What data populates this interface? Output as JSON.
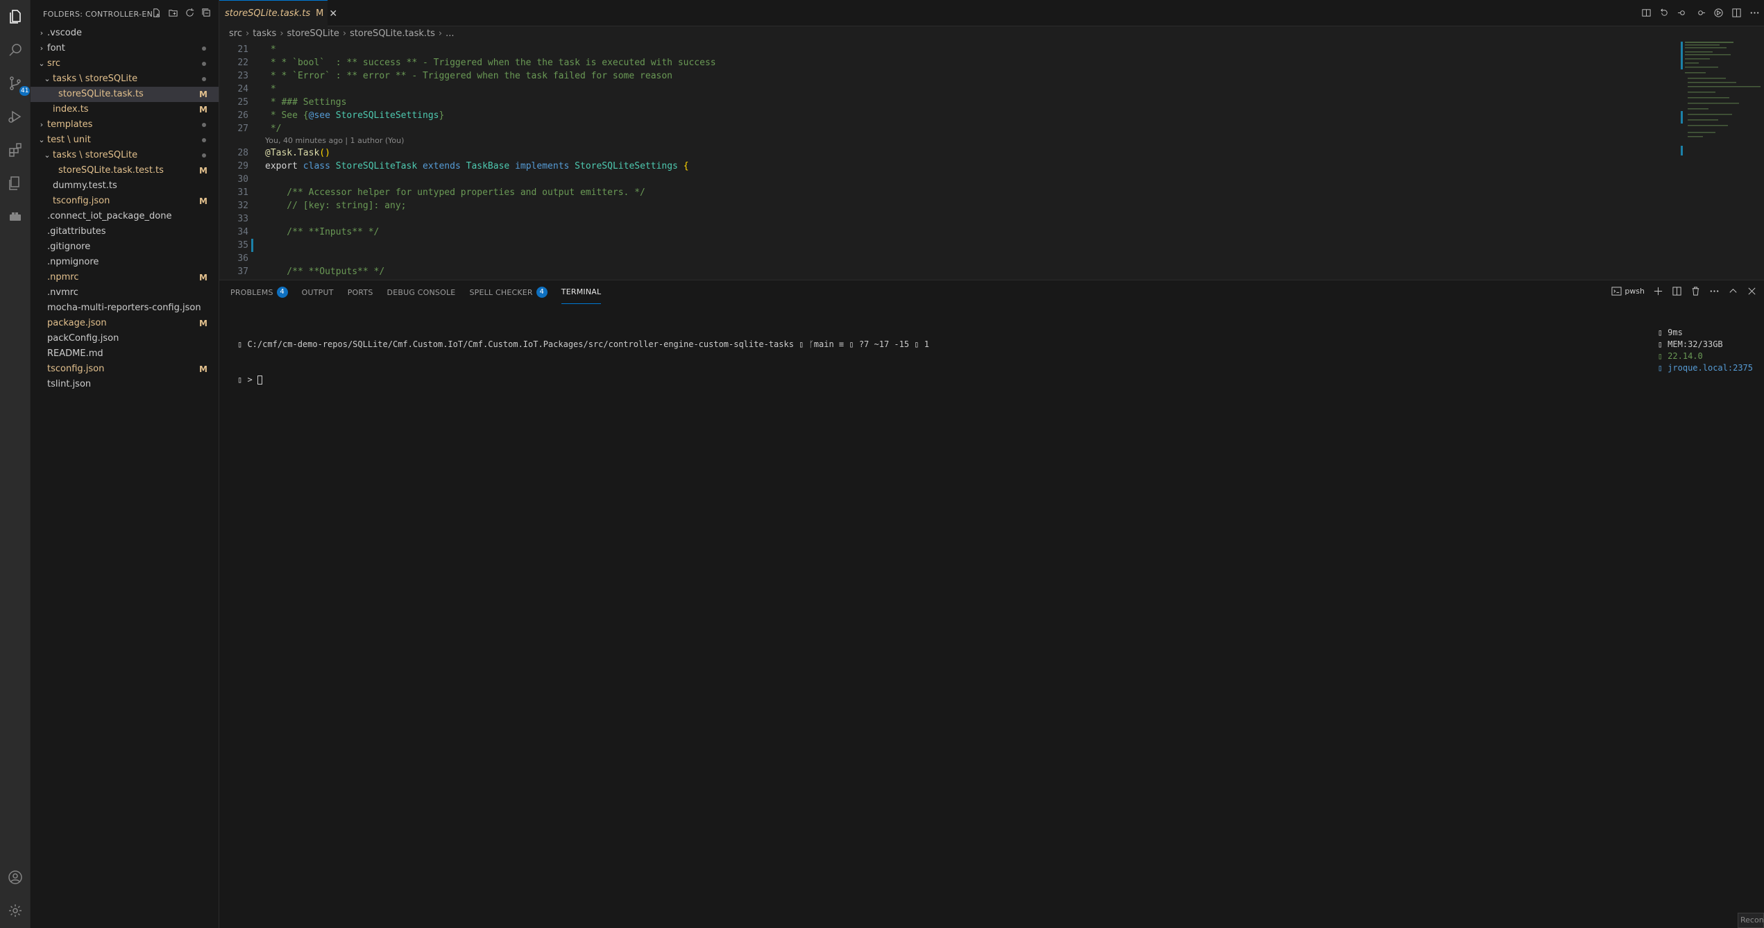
{
  "activity_bar": {
    "scm_badge": "41",
    "icons": [
      "explorer-icon",
      "search-icon",
      "source-control-icon",
      "run-debug-icon",
      "extensions-icon",
      "remote-explorer-icon",
      "docker-icon",
      "account-icon",
      "settings-gear-icon"
    ]
  },
  "sidebar": {
    "title": "FOLDERS: CONTROLLER-EN...",
    "tree": [
      {
        "label": ".vscode",
        "kind": "folder",
        "open": false,
        "depth": 0,
        "status": ""
      },
      {
        "label": "font",
        "kind": "folder",
        "open": false,
        "depth": 0,
        "status": "dot"
      },
      {
        "label": "src",
        "kind": "folder",
        "open": true,
        "depth": 0,
        "status": "dot",
        "color": "orange"
      },
      {
        "label": "tasks \\ storeSQLite",
        "kind": "folder",
        "open": true,
        "depth": 1,
        "status": "dot",
        "color": "orange"
      },
      {
        "label": "storeSQLite.task.ts",
        "kind": "file",
        "depth": 2,
        "status": "M",
        "color": "orange",
        "selected": true
      },
      {
        "label": "index.ts",
        "kind": "file",
        "depth": 1,
        "status": "M",
        "color": "orange"
      },
      {
        "label": "templates",
        "kind": "folder",
        "open": false,
        "depth": 0,
        "status": "dot",
        "color": "orange"
      },
      {
        "label": "test \\ unit",
        "kind": "folder",
        "open": true,
        "depth": 0,
        "status": "dot",
        "color": "orange"
      },
      {
        "label": "tasks \\ storeSQLite",
        "kind": "folder",
        "open": true,
        "depth": 1,
        "status": "dot",
        "color": "orange"
      },
      {
        "label": "storeSQLite.task.test.ts",
        "kind": "file",
        "depth": 2,
        "status": "M",
        "color": "orange"
      },
      {
        "label": "dummy.test.ts",
        "kind": "file",
        "depth": 1,
        "status": ""
      },
      {
        "label": "tsconfig.json",
        "kind": "file",
        "depth": 1,
        "status": "M",
        "color": "orange"
      },
      {
        "label": ".connect_iot_package_done",
        "kind": "file",
        "depth": 0,
        "status": ""
      },
      {
        "label": ".gitattributes",
        "kind": "file",
        "depth": 0,
        "status": ""
      },
      {
        "label": ".gitignore",
        "kind": "file",
        "depth": 0,
        "status": ""
      },
      {
        "label": ".npmignore",
        "kind": "file",
        "depth": 0,
        "status": ""
      },
      {
        "label": ".npmrc",
        "kind": "file",
        "depth": 0,
        "status": "M",
        "color": "orange"
      },
      {
        "label": ".nvmrc",
        "kind": "file",
        "depth": 0,
        "status": ""
      },
      {
        "label": "mocha-multi-reporters-config.json",
        "kind": "file",
        "depth": 0,
        "status": ""
      },
      {
        "label": "package.json",
        "kind": "file",
        "depth": 0,
        "status": "M",
        "color": "orange"
      },
      {
        "label": "packConfig.json",
        "kind": "file",
        "depth": 0,
        "status": ""
      },
      {
        "label": "README.md",
        "kind": "file",
        "depth": 0,
        "status": ""
      },
      {
        "label": "tsconfig.json",
        "kind": "file",
        "depth": 0,
        "status": "M",
        "color": "orange"
      },
      {
        "label": "tslint.json",
        "kind": "file",
        "depth": 0,
        "status": ""
      }
    ]
  },
  "editor": {
    "tab": {
      "label": "storeSQLite.task.ts",
      "modified": "M",
      "close": "✕"
    },
    "breadcrumb": [
      "src",
      "tasks",
      "storeSQLite",
      "storeSQLite.task.ts",
      "..."
    ],
    "codelens": "You, 40 minutes ago | 1 author (You)",
    "lines": [
      {
        "n": "21",
        "segs": [
          {
            "t": " *",
            "c": "cm"
          }
        ]
      },
      {
        "n": "22",
        "segs": [
          {
            "t": " * * `bool`  : ** success ** - Triggered when the the task is executed with success",
            "c": "cm"
          }
        ]
      },
      {
        "n": "23",
        "segs": [
          {
            "t": " * * `Error` : ** error ** - Triggered when the task failed for some reason",
            "c": "cm"
          }
        ]
      },
      {
        "n": "24",
        "segs": [
          {
            "t": " *",
            "c": "cm"
          }
        ]
      },
      {
        "n": "25",
        "segs": [
          {
            "t": " * ### Settings",
            "c": "cm"
          }
        ]
      },
      {
        "n": "26",
        "segs": [
          {
            "t": " * See {",
            "c": "cm"
          },
          {
            "t": "@see",
            "c": "kw"
          },
          {
            "t": " StoreSQLiteSettings",
            "c": "ty"
          },
          {
            "t": "}",
            "c": "cm"
          }
        ]
      },
      {
        "n": "27",
        "segs": [
          {
            "t": " */",
            "c": "cm"
          }
        ]
      },
      {
        "n": "28",
        "segs": [
          {
            "t": "@Task.Task",
            "c": "dec"
          },
          {
            "t": "()",
            "c": "br"
          }
        ]
      },
      {
        "n": "29",
        "segs": [
          {
            "t": "export ",
            "c": "pl"
          },
          {
            "t": "class ",
            "c": "kw"
          },
          {
            "t": "StoreSQLiteTask ",
            "c": "ty"
          },
          {
            "t": "extends ",
            "c": "kw"
          },
          {
            "t": "TaskBase ",
            "c": "ty"
          },
          {
            "t": "implements ",
            "c": "kw"
          },
          {
            "t": "StoreSQLiteSettings ",
            "c": "ty"
          },
          {
            "t": "{",
            "c": "br"
          }
        ]
      },
      {
        "n": "30",
        "segs": []
      },
      {
        "n": "31",
        "segs": [
          {
            "t": "    /** Accessor helper for untyped properties and output emitters. */",
            "c": "cm"
          }
        ]
      },
      {
        "n": "32",
        "segs": [
          {
            "t": "    // [key: string]: any;",
            "c": "cm"
          }
        ]
      },
      {
        "n": "33",
        "segs": []
      },
      {
        "n": "34",
        "segs": [
          {
            "t": "    /** **Inputs** */",
            "c": "cm"
          }
        ]
      },
      {
        "n": "35",
        "segs": []
      },
      {
        "n": "36",
        "segs": []
      },
      {
        "n": "37",
        "segs": [
          {
            "t": "    /** **Outputs** */",
            "c": "cm"
          }
        ]
      }
    ]
  },
  "panel": {
    "tabs": [
      {
        "label": "PROBLEMS",
        "badge": "4"
      },
      {
        "label": "OUTPUT",
        "badge": ""
      },
      {
        "label": "PORTS",
        "badge": ""
      },
      {
        "label": "DEBUG CONSOLE",
        "badge": ""
      },
      {
        "label": "SPELL CHECKER",
        "badge": "4"
      },
      {
        "label": "TERMINAL",
        "badge": "",
        "active": true
      }
    ],
    "shell_label": "pwsh",
    "terminal": {
      "line1": "▯ C:/cmf/cm-demo-repos/SQLLite/Cmf.Custom.IoT/Cmf.Custom.IoT.Packages/src/controller-engine-custom-sqlite-tasks ▯ ᚴmain ≡ ▯ ?7 ~17 -15 ▯ 1",
      "line2": "▯ > ",
      "status_time": "▯ 9ms",
      "status_mem": "▯ MEM:32/33GB",
      "status_node": "▯ 22.14.0",
      "status_host": "▯ jroque.local:2375"
    }
  },
  "corner_status": "Recon",
  "colors": {
    "accent": "#0078d4",
    "modified": "#e2c08d",
    "badge": "#0e70c0"
  }
}
